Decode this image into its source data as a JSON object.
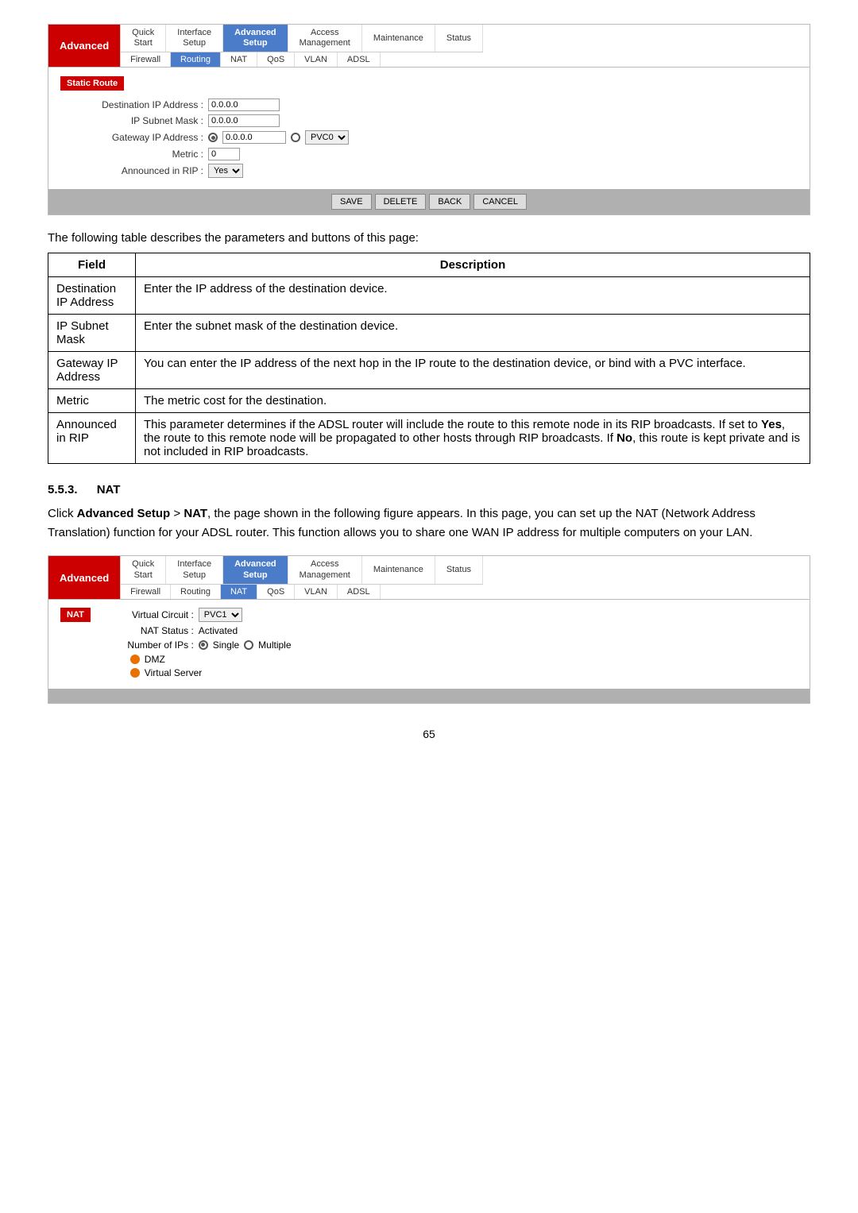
{
  "panel1": {
    "brand": "Advanced",
    "nav_top": [
      {
        "label": "Quick\nStart",
        "active": false
      },
      {
        "label": "Interface\nSetup",
        "active": false
      },
      {
        "label": "Advanced\nSetup",
        "active": true
      },
      {
        "label": "Access\nManagement",
        "active": false
      },
      {
        "label": "Maintenance",
        "active": false
      },
      {
        "label": "Status",
        "active": false
      }
    ],
    "nav_bottom": [
      {
        "label": "Firewall",
        "active": false
      },
      {
        "label": "Routing",
        "active": true
      },
      {
        "label": "NAT",
        "active": false
      },
      {
        "label": "QoS",
        "active": false
      },
      {
        "label": "VLAN",
        "active": false
      },
      {
        "label": "ADSL",
        "active": false
      }
    ],
    "section_label": "Static Route",
    "form": {
      "destination_ip_label": "Destination IP Address :",
      "destination_ip_value": "0.0.0.0",
      "subnet_mask_label": "IP Subnet Mask :",
      "subnet_mask_value": "0.0.0.0",
      "gateway_ip_label": "Gateway IP Address :",
      "gateway_ip_value": "0.0.0.0",
      "gateway_pvc_value": "PVC0",
      "metric_label": "Metric :",
      "metric_value": "0",
      "announced_label": "Announced in RIP :",
      "announced_value": "Yes"
    },
    "buttons": [
      "SAVE",
      "DELETE",
      "BACK",
      "CANCEL"
    ]
  },
  "desc_text": "The following table describes the parameters and buttons of this page:",
  "table": {
    "col_field": "Field",
    "col_desc": "Description",
    "rows": [
      {
        "field": "Destination\nIP Address",
        "desc": "Enter the IP address of the destination device."
      },
      {
        "field": "IP Subnet\nMask",
        "desc": "Enter the subnet mask of the destination device."
      },
      {
        "field": "Gateway IP\nAddress",
        "desc": "You can enter the IP address of the next hop in the IP route to the destination device, or bind with a PVC interface."
      },
      {
        "field": "Metric",
        "desc": "The metric cost for the destination."
      },
      {
        "field": "Announced\nin RIP",
        "desc": "This parameter determines if the ADSL router will include the route to this remote node in its RIP broadcasts. If set to Yes, the route to this remote node will be propagated to other hosts through RIP broadcasts. If No, this route is kept private and is not included in RIP broadcasts."
      }
    ]
  },
  "section553": {
    "number": "5.5.3.",
    "title": "NAT"
  },
  "body_text": "Click Advanced Setup > NAT, the page shown in the following figure appears. In this page, you can set up the NAT (Network Address Translation) function for your ADSL router. This function allows you to share one WAN IP address for multiple computers on your LAN.",
  "panel2": {
    "brand": "Advanced",
    "nav_top": [
      {
        "label": "Quick\nStart",
        "active": false
      },
      {
        "label": "Interface\nSetup",
        "active": false
      },
      {
        "label": "Advanced\nSetup",
        "active": true
      },
      {
        "label": "Access\nManagement",
        "active": false
      },
      {
        "label": "Maintenance",
        "active": false
      },
      {
        "label": "Status",
        "active": false
      }
    ],
    "nav_bottom": [
      {
        "label": "Firewall",
        "active": false
      },
      {
        "label": "Routing",
        "active": false
      },
      {
        "label": "NAT",
        "active": true
      },
      {
        "label": "QoS",
        "active": false
      },
      {
        "label": "VLAN",
        "active": false
      },
      {
        "label": "ADSL",
        "active": false
      }
    ],
    "section_label": "NAT",
    "form": {
      "virtual_circuit_label": "Virtual Circuit :",
      "virtual_circuit_value": "PVC1",
      "nat_status_label": "NAT Status :",
      "nat_status_value": "Activated",
      "num_ips_label": "Number of IPs :",
      "num_ips_single": "Single",
      "num_ips_multiple": "Multiple",
      "items": [
        "DMZ",
        "Virtual Server"
      ]
    }
  },
  "page_number": "65"
}
